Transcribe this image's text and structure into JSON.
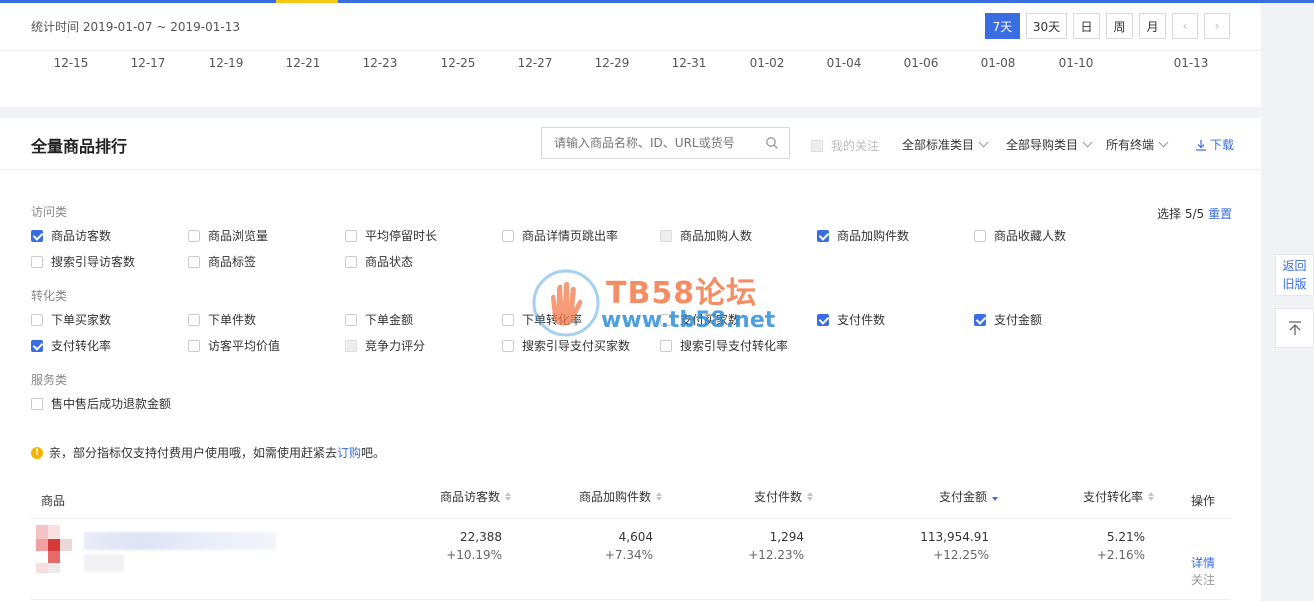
{
  "header": {
    "stat_range": "统计时间 2019-01-07 ~ 2019-01-13",
    "periods": [
      "7天",
      "30天",
      "日",
      "周",
      "月"
    ],
    "active_period": "7天",
    "x_ticks": [
      "12-15",
      "12-17",
      "12-19",
      "12-21",
      "12-23",
      "12-25",
      "12-27",
      "12-29",
      "12-31",
      "01-02",
      "01-04",
      "01-06",
      "01-08",
      "01-10",
      "01-13"
    ]
  },
  "ranking": {
    "title": "全量商品排行",
    "search_placeholder": "请输入商品名称、ID、URL或货号",
    "my_follow": "我的关注",
    "dropdowns": [
      "全部标准类目",
      "全部导购类目",
      "所有终端"
    ],
    "download": "下载",
    "select_count": "选择 5/5",
    "reset": "重置",
    "categories": [
      {
        "label": "访问类",
        "options": [
          {
            "label": "商品访客数",
            "state": "checked"
          },
          {
            "label": "商品浏览量",
            "state": "unchecked"
          },
          {
            "label": "平均停留时长",
            "state": "unchecked"
          },
          {
            "label": "商品详情页跳出率",
            "state": "unchecked"
          },
          {
            "label": "商品加购人数",
            "state": "disabled"
          },
          {
            "label": "商品加购件数",
            "state": "checked"
          },
          {
            "label": "商品收藏人数",
            "state": "unchecked"
          },
          {
            "label": "搜索引导访客数",
            "state": "unchecked"
          },
          {
            "label": "商品标签",
            "state": "unchecked"
          },
          {
            "label": "商品状态",
            "state": "unchecked"
          }
        ]
      },
      {
        "label": "转化类",
        "options": [
          {
            "label": "下单买家数",
            "state": "unchecked"
          },
          {
            "label": "下单件数",
            "state": "unchecked"
          },
          {
            "label": "下单金额",
            "state": "unchecked"
          },
          {
            "label": "下单转化率",
            "state": "unchecked"
          },
          {
            "label": "支付买家数",
            "state": "unchecked"
          },
          {
            "label": "支付件数",
            "state": "checked"
          },
          {
            "label": "支付金额",
            "state": "checked"
          },
          {
            "label": "支付转化率",
            "state": "checked"
          },
          {
            "label": "访客平均价值",
            "state": "unchecked"
          },
          {
            "label": "竞争力评分",
            "state": "disabled"
          },
          {
            "label": "搜索引导支付买家数",
            "state": "unchecked"
          },
          {
            "label": "搜索引导支付转化率",
            "state": "unchecked"
          }
        ]
      },
      {
        "label": "服务类",
        "options": [
          {
            "label": "售中售后成功退款金额",
            "state": "unchecked"
          }
        ]
      }
    ],
    "notice_prefix": "亲，部分指标仅支持付费用户使用哦，如需使用赶紧去",
    "notice_link": "订购",
    "notice_suffix": "吧。",
    "table": {
      "headers": {
        "product": "商品",
        "visitors": "商品访客数",
        "cart_items": "商品加购件数",
        "pay_items": "支付件数",
        "pay_amount": "支付金额",
        "pay_rate": "支付转化率",
        "ops": "操作"
      },
      "rows": [
        {
          "visitors": "22,388",
          "visitors_delta": "+10.19%",
          "cart_items": "4,604",
          "cart_items_delta": "+7.34%",
          "pay_items": "1,294",
          "pay_items_delta": "+12.23%",
          "pay_amount": "113,954.91",
          "pay_amount_delta": "+12.25%",
          "pay_rate": "5.21%",
          "pay_rate_delta": "+2.16%",
          "detail": "详情",
          "follow": "关注"
        }
      ]
    }
  },
  "watermark": {
    "line1": "TB58论坛",
    "line2": "www.tb58.net"
  },
  "side": {
    "back_line1": "返回",
    "back_line2": "旧版"
  },
  "colors": {
    "accent": "#3a6de0",
    "indicator": "#f5c518"
  }
}
